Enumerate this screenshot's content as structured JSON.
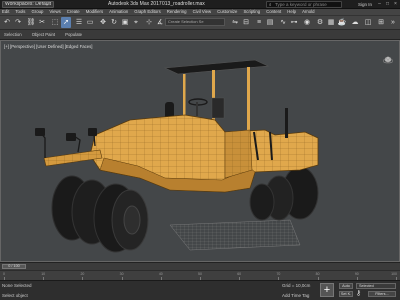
{
  "titlebar": {
    "workspace": "Workspaces: Default",
    "app": "Autodesk 3ds Max 2017",
    "file": "013_roadroller.max",
    "search_placeholder": "Type a keyword or phrase",
    "signin": "Sign In"
  },
  "menus": [
    "Edit",
    "Tools",
    "Group",
    "Views",
    "Create",
    "Modifiers",
    "Animation",
    "Graph Editors",
    "Rendering",
    "Civil View",
    "Customize",
    "Scripting",
    "Content",
    "Help",
    "Arnold"
  ],
  "toolbar": {
    "selection_set": "Create Selection Se"
  },
  "ribbon": {
    "tabs": [
      "Selection",
      "Object Paint",
      "Populate"
    ]
  },
  "viewport": {
    "label": "[+] [Perspective] [User Defined] [Edged Faces]"
  },
  "timeline": {
    "frame": "0 / 100",
    "ticks": [
      "0",
      "10",
      "20",
      "30",
      "40",
      "50",
      "60",
      "70",
      "80",
      "90",
      "100"
    ]
  },
  "status": {
    "line1": "None Selected",
    "line2": "Select object",
    "grid": "Grid = 10,0cm",
    "add_tag": "Add Time Tag",
    "autokey": "Auto",
    "setkey": "Set K.",
    "selected": "Selected",
    "filters": "Filters..."
  },
  "colors": {
    "model_face": "#e0a84c",
    "model_dark": "#b8802f",
    "tire": "#1a1a1a",
    "viewport_bg": "#444749",
    "accent": "#5b7faf"
  }
}
